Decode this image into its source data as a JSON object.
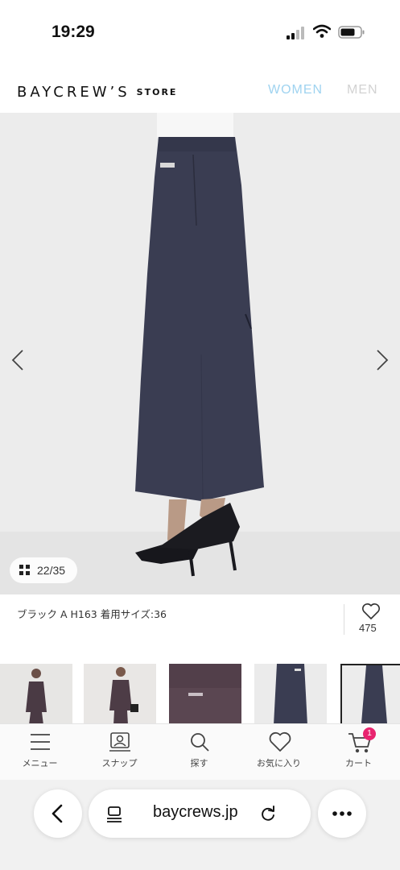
{
  "status_bar": {
    "time": "19:29"
  },
  "header": {
    "logo": "BAYCREW’S",
    "logo_sub": "STORE",
    "nav": [
      {
        "label": "WOMEN",
        "color": "#9fd3f0"
      },
      {
        "label": "MEN",
        "color": "#d2d2d2"
      }
    ]
  },
  "product_image": {
    "counter": "22/35",
    "icons": [
      "chevron-left-icon",
      "chevron-right-icon",
      "grid-icon"
    ]
  },
  "caption": {
    "text": "ブラック A H163 着用サイズ:36"
  },
  "favorite": {
    "count": "475",
    "icon": "heart-icon"
  },
  "thumbnails": {
    "count_visible": 5,
    "selected_index": 4
  },
  "tabbar": {
    "items": [
      {
        "label": "メニュー",
        "icon": "menu-icon"
      },
      {
        "label": "スナップ",
        "icon": "snap-icon"
      },
      {
        "label": "探す",
        "icon": "search-icon"
      },
      {
        "label": "お気に入り",
        "icon": "heart-icon"
      },
      {
        "label": "カート",
        "icon": "cart-icon",
        "badge": "1",
        "badge_color": "#e8246f"
      }
    ]
  },
  "browser": {
    "domain": "baycrews.jp"
  }
}
